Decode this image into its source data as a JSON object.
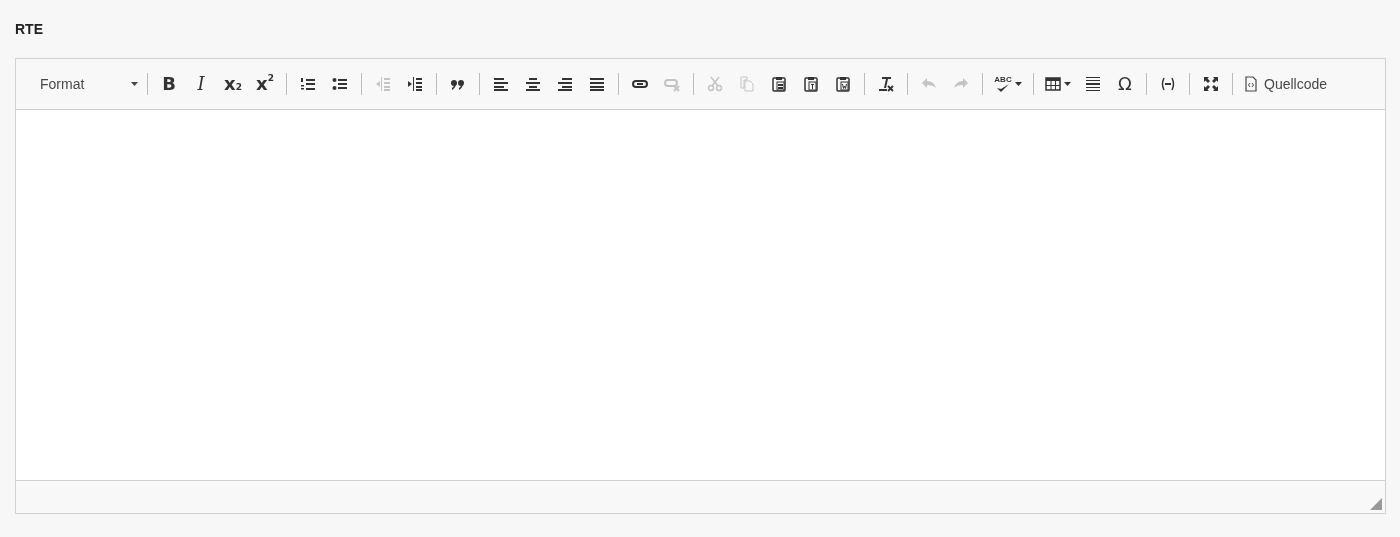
{
  "field_label": "RTE",
  "toolbar": [
    [
      {
        "kind": "combo",
        "label": "Format",
        "disabled": false
      }
    ],
    [
      {
        "kind": "bold",
        "glyph": "B",
        "disabled": false
      },
      {
        "kind": "italic",
        "glyph": "I",
        "disabled": false
      },
      {
        "kind": "subscript",
        "glyph": "x",
        "sub": "2",
        "disabled": false
      },
      {
        "kind": "superscript",
        "glyph": "x",
        "sup": "2",
        "disabled": false
      }
    ],
    [
      {
        "kind": "numbered-list",
        "disabled": false
      },
      {
        "kind": "bulleted-list",
        "disabled": false
      }
    ],
    [
      {
        "kind": "outdent",
        "disabled": true
      },
      {
        "kind": "indent",
        "disabled": false
      }
    ],
    [
      {
        "kind": "blockquote",
        "disabled": false
      }
    ],
    [
      {
        "kind": "align-left",
        "disabled": false
      },
      {
        "kind": "align-center",
        "disabled": false
      },
      {
        "kind": "align-right",
        "disabled": false
      },
      {
        "kind": "align-justify",
        "disabled": false
      }
    ],
    [
      {
        "kind": "link",
        "disabled": false
      },
      {
        "kind": "unlink",
        "disabled": true
      }
    ],
    [
      {
        "kind": "cut",
        "disabled": true
      },
      {
        "kind": "copy",
        "disabled": true
      },
      {
        "kind": "paste",
        "disabled": false
      },
      {
        "kind": "paste-text",
        "disabled": false
      },
      {
        "kind": "paste-word",
        "disabled": false
      }
    ],
    [
      {
        "kind": "remove-format",
        "disabled": false
      }
    ],
    [
      {
        "kind": "undo",
        "disabled": true
      },
      {
        "kind": "redo",
        "disabled": true
      }
    ],
    [
      {
        "kind": "spellcheck",
        "glyph": "ABC",
        "disabled": false
      }
    ],
    [
      {
        "kind": "table",
        "disabled": false
      },
      {
        "kind": "horizontal-line",
        "disabled": false
      },
      {
        "kind": "special-char",
        "glyph": "Ω",
        "disabled": false
      }
    ],
    [
      {
        "kind": "placeholder",
        "disabled": false
      }
    ],
    [
      {
        "kind": "maximize",
        "disabled": false
      }
    ],
    [
      {
        "kind": "source",
        "label": "Quellcode",
        "disabled": false
      }
    ]
  ]
}
